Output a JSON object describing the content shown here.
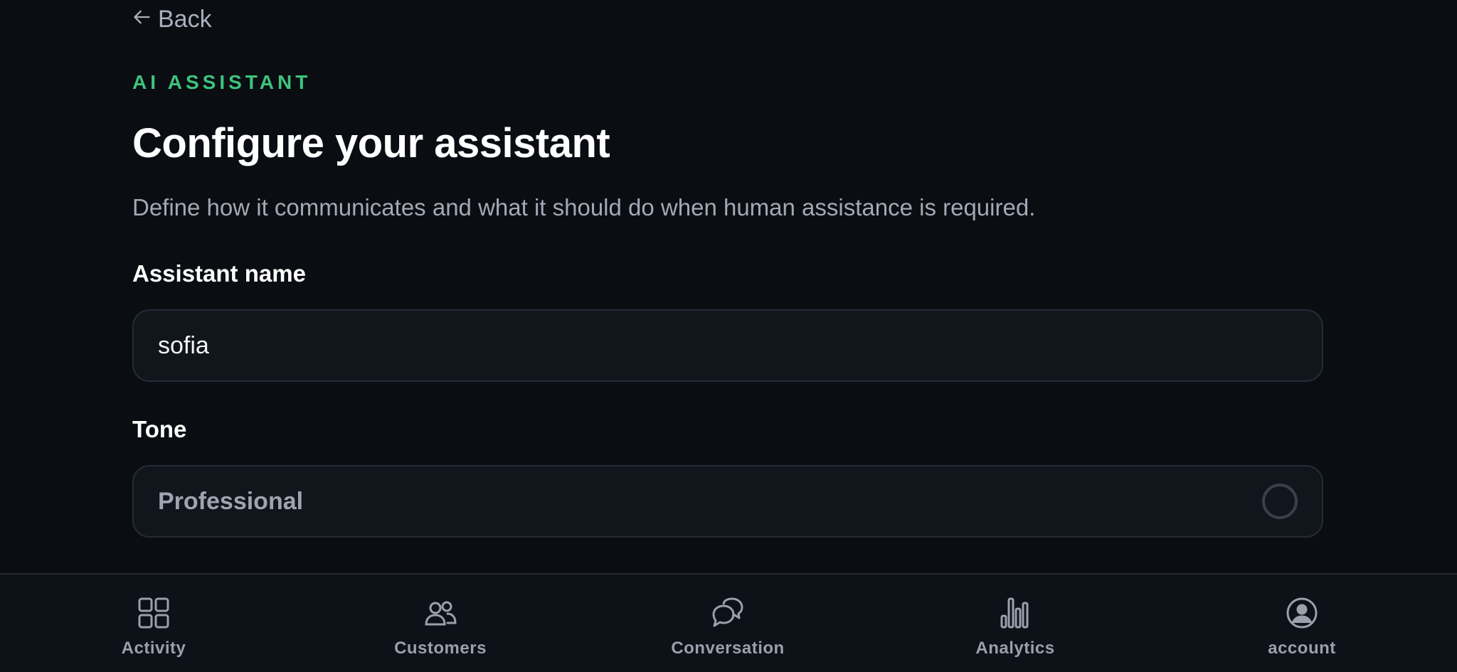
{
  "header": {
    "back_label": "Back",
    "eyebrow": "AI ASSISTANT",
    "title": "Configure your assistant",
    "subtitle": "Define how it communicates and what it should do when human assistance is required."
  },
  "form": {
    "name_label": "Assistant name",
    "name_value": "sofia",
    "tone_label": "Tone",
    "tone_value": "Professional"
  },
  "nav": {
    "items": [
      {
        "label": "Activity",
        "icon": "grid-icon"
      },
      {
        "label": "Customers",
        "icon": "users-icon"
      },
      {
        "label": "Conversation",
        "icon": "chat-bubbles-icon"
      },
      {
        "label": "Analytics",
        "icon": "bar-chart-icon"
      },
      {
        "label": "account",
        "icon": "user-circle-icon"
      }
    ]
  },
  "colors": {
    "background": "#0a0d12",
    "accent": "#3ec47c",
    "field_background": "#11151c",
    "field_border": "#262b35",
    "muted_text": "#a3a9b5"
  }
}
